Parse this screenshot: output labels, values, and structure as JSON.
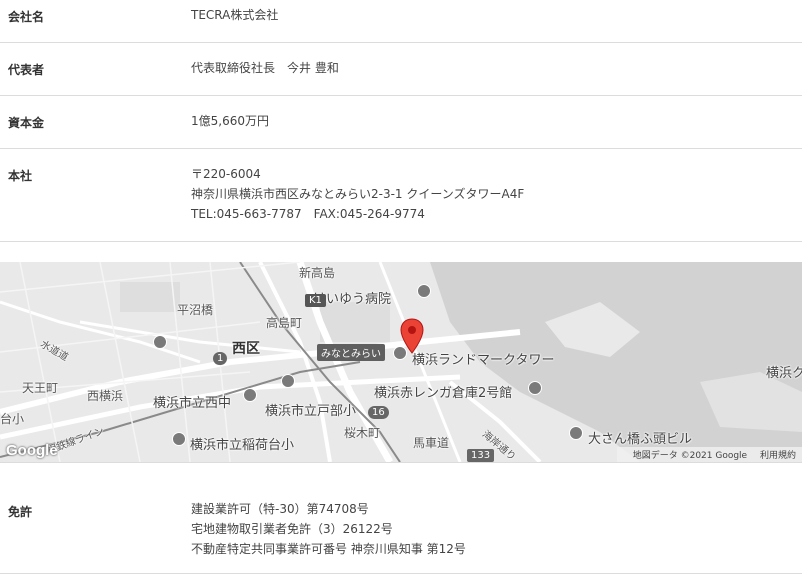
{
  "company": {
    "name_label": "会社名",
    "name_value": "TECRA株式会社",
    "rep_label": "代表者",
    "rep_value": "代表取締役社長　今井 豊和",
    "capital_label": "資本金",
    "capital_value": "1億5,660万円",
    "hq_label": "本社",
    "hq_zip": "〒220-6004",
    "hq_address": "神奈川県横浜市西区みなとみらい2-3-1 クイーンズタワーA4F",
    "hq_contact": "TEL:045-663-7787　FAX:045-264-9774",
    "license_label": "免許",
    "license_1": "建設業許可（特-30）第74708号",
    "license_2": "宅地建物取引業者免許（3）26122号",
    "license_3": "不動産特定共同事業許可番号 神奈川県知事 第12号"
  },
  "map": {
    "poi_shintakashima": "新高島",
    "poi_keiyu": "けいゆう病院",
    "poi_hiranuma": "平沼橋",
    "poi_takashimacho": "高島町",
    "poi_minatomirai": "みなとみらい",
    "poi_landmark": "横浜ランドマークタワー",
    "poi_nishiku": "西区",
    "poi_akarenga": "横浜赤レンガ倉庫2号館",
    "poi_nishinaka": "横浜市立西中",
    "poi_tobe": "横浜市立戸部小",
    "poi_nishiyokohama": "西横浜",
    "poi_tennocho": "天王町",
    "poi_sakuragicho": "桜木町",
    "poi_bashamichi": "馬車道",
    "poi_osanbashi": "大さん橋ふ頭ビル",
    "poi_inari": "横浜市立稲荷台小",
    "poi_mizumichi": "水道道",
    "poi_yokohama_right": "横浜ク",
    "poi_daisho": "台小",
    "poi_kaigan": "海岸通り",
    "poi_line": "相鉄線ライン",
    "route_1": "1",
    "route_16": "16",
    "route_k1": "K1",
    "route_133": "133",
    "google": "Google",
    "map_data": "地図データ ©2021 Google",
    "terms": "利用規約",
    "pin_color": "#ea4335"
  }
}
